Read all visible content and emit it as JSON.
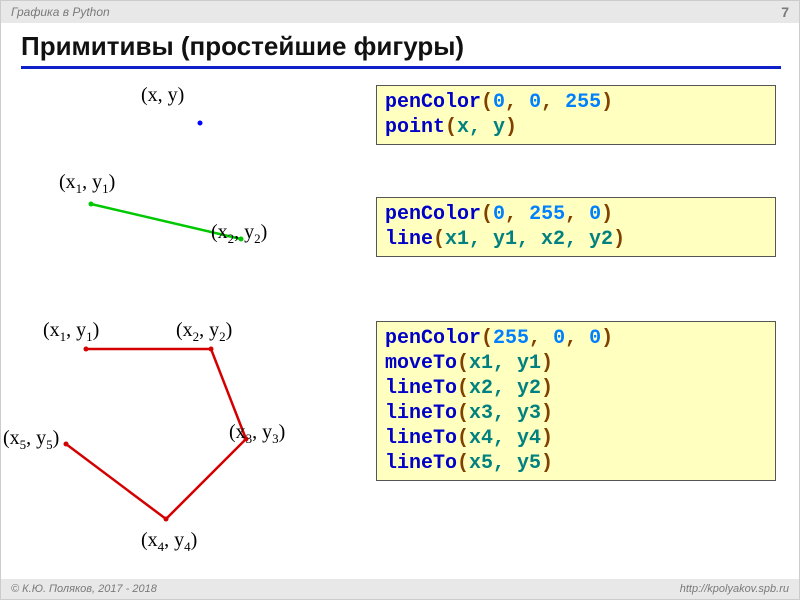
{
  "header": {
    "course": "Графика в Python",
    "page": "7"
  },
  "title": "Примитивы (простейшие фигуры)",
  "labels": {
    "pt": "(x, y)",
    "l1": "(x₁, y₁)",
    "l2": "(x₂, y₂)",
    "p1": "(x₁, y₁)",
    "p2": "(x₂, y₂)",
    "p3": "(x₃, y₃)",
    "p4": "(x₄, y₄)",
    "p5": "(x₅, y₅)"
  },
  "code1": {
    "fn1": "penColor",
    "args1": [
      "0",
      "0",
      "255"
    ],
    "fn2": "point",
    "args2": "x, y"
  },
  "code2": {
    "fn1": "penColor",
    "args1": [
      "0",
      "255",
      "0"
    ],
    "fn2": "line",
    "args2": "x1, y1, x2, y2"
  },
  "code3": {
    "fn1": "penColor",
    "args1": [
      "255",
      "0",
      "0"
    ],
    "fn2": "moveTo",
    "args2": "x1, y1",
    "fn3": "lineTo",
    "args3": "x2, y2",
    "fn4": "lineTo",
    "args4": "x3, y3",
    "fn5": "lineTo",
    "args5": "x4, y4",
    "fn6": "lineTo",
    "args6": "x5, y5"
  },
  "footer": {
    "copyright": "© К.Ю. Поляков, 2017 - 2018",
    "url": "http://kpolyakov.spb.ru"
  }
}
